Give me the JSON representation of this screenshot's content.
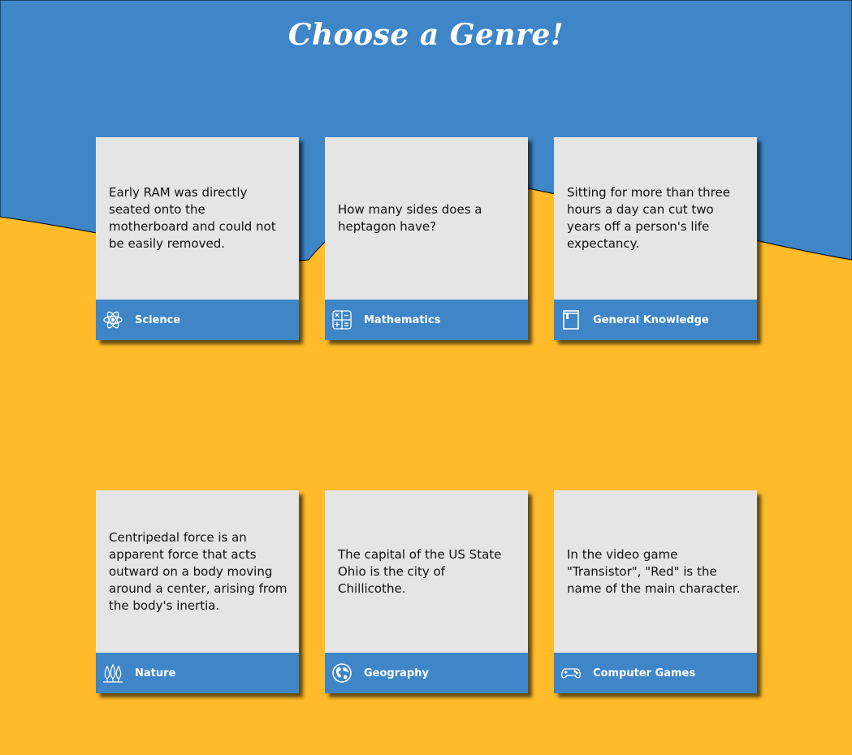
{
  "header": {
    "title": "Choose a Genre!"
  },
  "colors": {
    "top": "#3f86c8",
    "bottom": "#ffbb29",
    "card": "#e5e5e5",
    "footer": "#3f86c8"
  },
  "cards": [
    {
      "text": "Early RAM was directly seated onto the motherboard and could not be easily removed.",
      "genre": "Science",
      "icon": "atom-icon"
    },
    {
      "text": "How many sides does a heptagon have?",
      "genre": "Mathematics",
      "icon": "calculator-icon"
    },
    {
      "text": "Sitting for more than three hours a day can cut two years off a person's life expectancy.",
      "genre": "General Knowledge",
      "icon": "book-icon"
    },
    {
      "text": "Centripedal force is an apparent force that acts outward on a body moving around a center, arising from the body's inertia.",
      "genre": "Nature",
      "icon": "trees-icon"
    },
    {
      "text": "The capital of the US State Ohio is the city of Chillicothe.",
      "genre": "Geography",
      "icon": "globe-icon"
    },
    {
      "text": "In the video game \"Transistor\", \"Red\" is the name of the main character.",
      "genre": "Computer Games",
      "icon": "gamepad-icon"
    }
  ]
}
